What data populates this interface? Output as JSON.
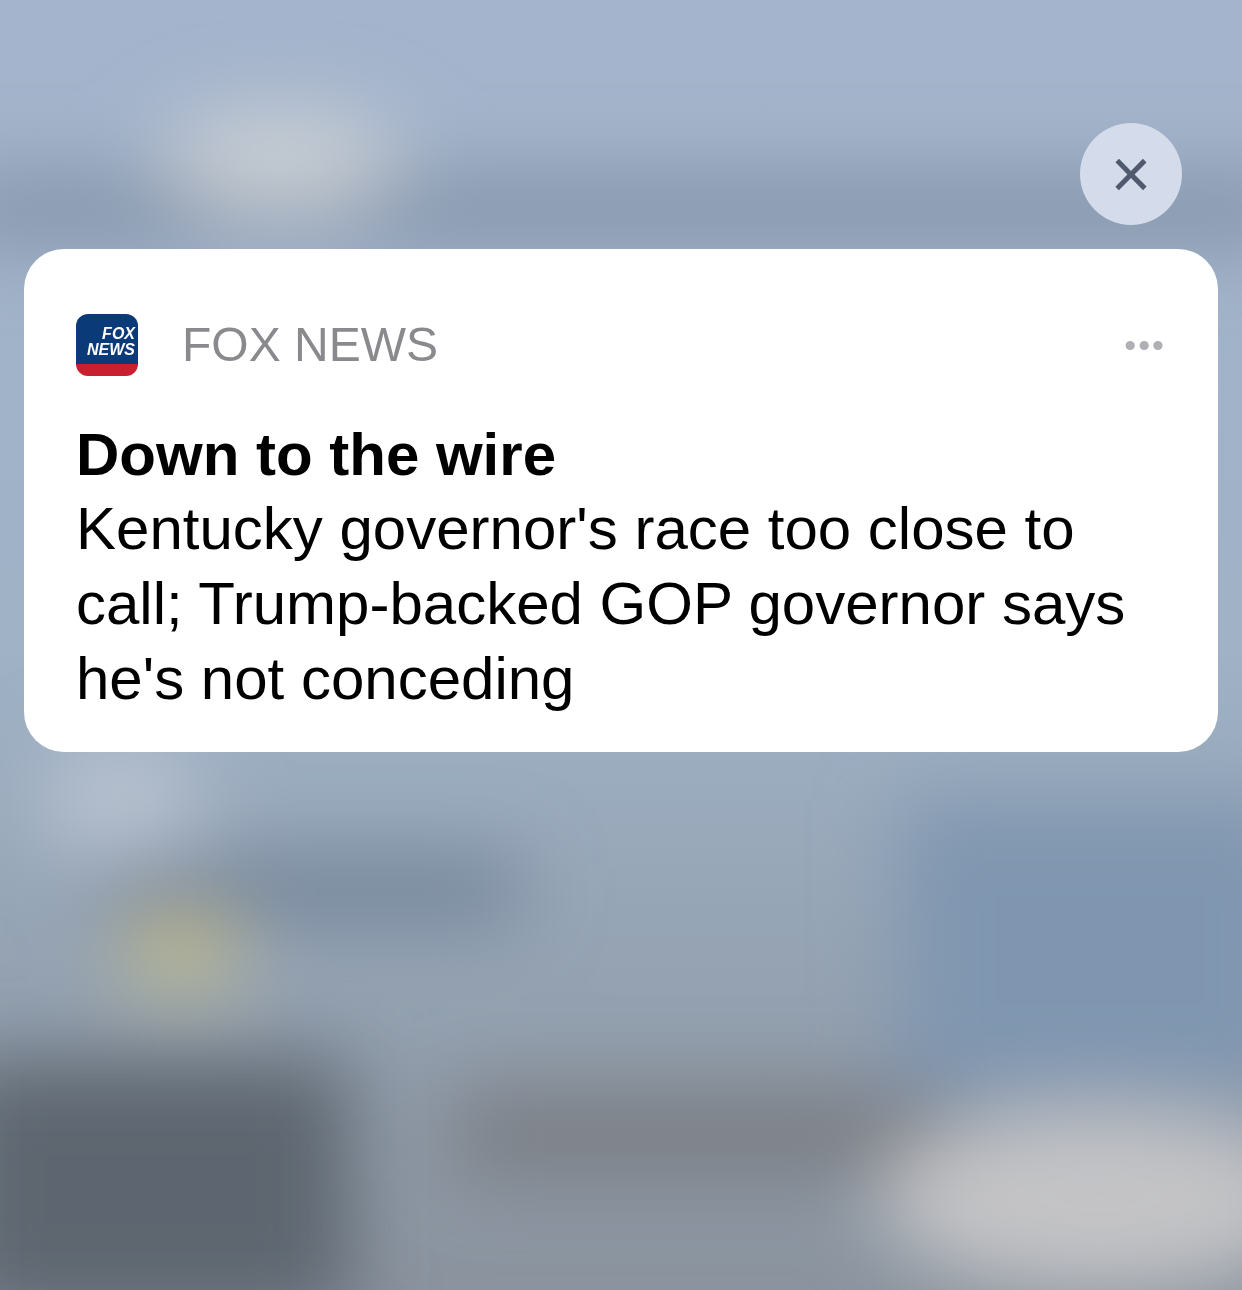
{
  "close_button": {
    "label": "×"
  },
  "notification": {
    "app": {
      "name": "FOX NEWS",
      "icon_text": [
        "FOX",
        "NEWS"
      ]
    },
    "more": "•••",
    "title": "Down to the wire",
    "body": "Kentucky governor's race too close to call; Trump-backed GOP governor says he's not conceding"
  }
}
